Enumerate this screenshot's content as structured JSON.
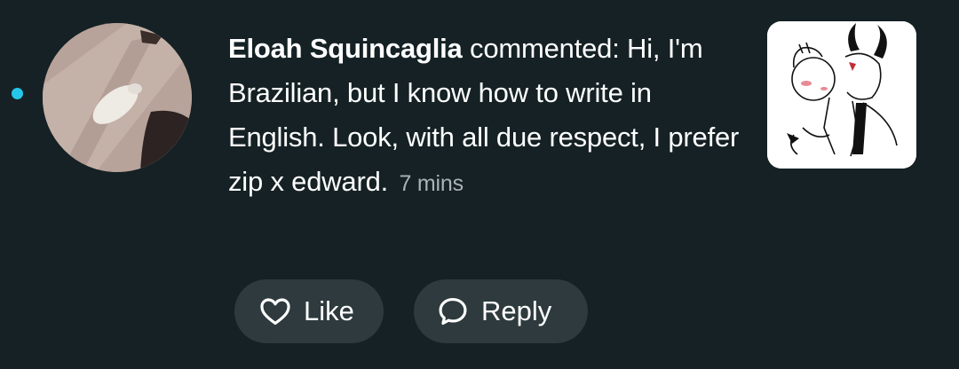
{
  "comment": {
    "author": "Eloah Squincaglia",
    "action": "commented:",
    "text": "Hi, I'm Brazilian, but I know how to write in English. Look, with all due respect, I prefer zip x edward.",
    "time": "7 mins",
    "unread": true
  },
  "buttons": {
    "like_label": "Like",
    "like_icon": "heart-icon",
    "reply_label": "Reply",
    "reply_icon": "speech-bubble-icon"
  },
  "colors": {
    "background": "#152124",
    "unread_dot": "#25c6ea",
    "button_background": "#2e3a3d",
    "text": "#ffffff",
    "secondary_text": "#aab3b6"
  }
}
